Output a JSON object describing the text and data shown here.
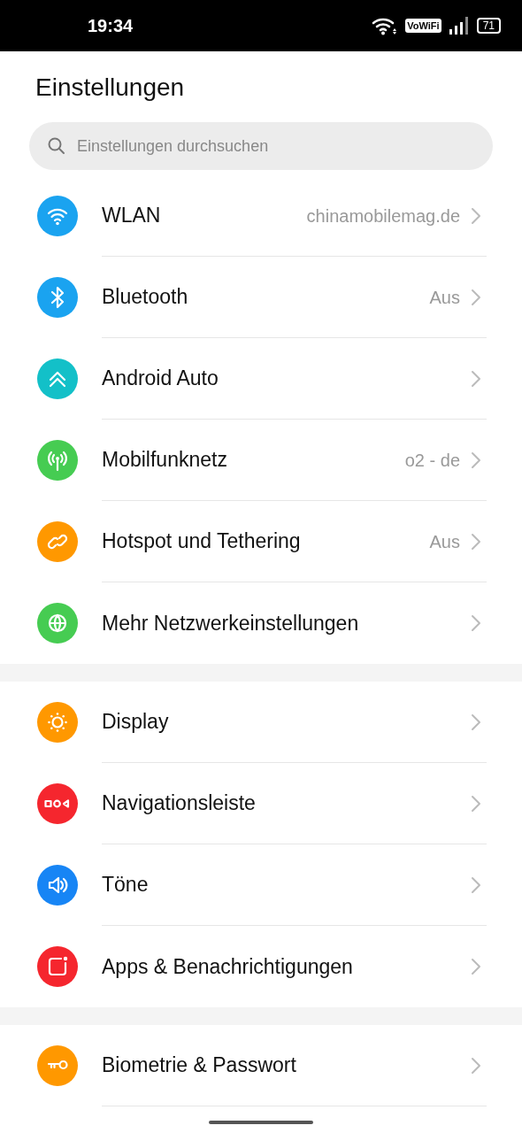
{
  "status_bar": {
    "time": "19:34",
    "vowifi": "VoWiFi",
    "battery": "71"
  },
  "title": "Einstellungen",
  "search": {
    "placeholder": "Einstellungen durchsuchen"
  },
  "sections": [
    {
      "items": [
        {
          "kind": "wifi",
          "color": "#1aa3f0",
          "label": "WLAN",
          "value": "chinamobilemag.de"
        },
        {
          "kind": "bluetooth",
          "color": "#1aa3f0",
          "label": "Bluetooth",
          "value": "Aus"
        },
        {
          "kind": "auto",
          "color": "#13c0c8",
          "label": "Android Auto"
        },
        {
          "kind": "antenna",
          "color": "#46cc52",
          "label": "Mobilfunknetz",
          "value": "o2 - de"
        },
        {
          "kind": "link",
          "color": "#ff9800",
          "label": "Hotspot und Tethering",
          "value": "Aus"
        },
        {
          "kind": "globe",
          "color": "#46cc52",
          "label": "Mehr Netzwerkeinstellungen"
        }
      ]
    },
    {
      "items": [
        {
          "kind": "sun",
          "color": "#ff9800",
          "label": "Display"
        },
        {
          "kind": "navbar",
          "color": "#f5262e",
          "label": "Navigationsleiste"
        },
        {
          "kind": "speaker",
          "color": "#1785f5",
          "label": "Töne"
        },
        {
          "kind": "apps",
          "color": "#f5262e",
          "label": "Apps & Benachrichtigungen"
        }
      ]
    },
    {
      "items": [
        {
          "kind": "key",
          "color": "#ff9800",
          "label": "Biometrie & Passwort"
        }
      ]
    }
  ]
}
